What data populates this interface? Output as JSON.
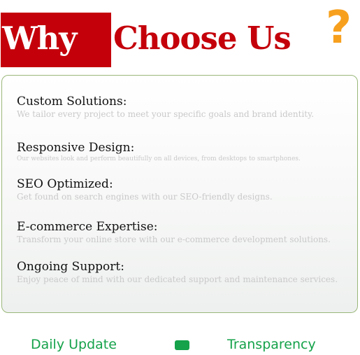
{
  "heading": {
    "why": "Why",
    "choose_us": "Choose Us",
    "question_mark": "?"
  },
  "features": [
    {
      "title": "Custom Solutions:",
      "description": "We tailor every project to meet your specific goals and brand identity."
    },
    {
      "title": "Responsive Design:",
      "description": "Our websites look and perform beautifully on all devices, from desktops to smartphones."
    },
    {
      "title": "SEO Optimized:",
      "description": "Get found on search engines with our SEO-friendly designs."
    },
    {
      "title": "E-commerce Expertise:",
      "description": "Transform your online store with our e-commerce development solutions."
    },
    {
      "title": "Ongoing Support:",
      "description": "Enjoy peace of mind with our dedicated support and maintenance services."
    }
  ],
  "footer": {
    "left_label": "Daily Update",
    "right_label": "Transparency"
  },
  "colors": {
    "brand_red": "#c4000a",
    "accent_orange": "#f7a01e",
    "accent_green": "#15a24a",
    "card_border": "#9ab77a",
    "muted_text": "#c9c9c9"
  }
}
